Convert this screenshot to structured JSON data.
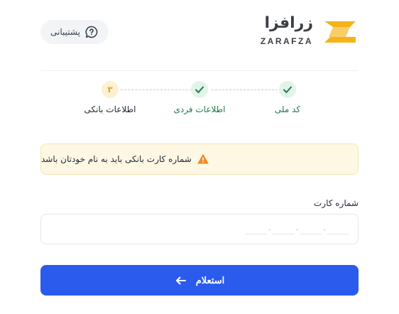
{
  "header": {
    "logo_fa": "زرافزا",
    "logo_en": "ZARAFZA",
    "support_label": "پشتیبانی",
    "brand_color": "#f5b31b"
  },
  "stepper": {
    "steps": [
      {
        "label": "کد ملی",
        "state": "done"
      },
      {
        "label": "اطلاعات فردی",
        "state": "done"
      },
      {
        "label": "اطلاعات بانکی",
        "state": "active",
        "number": "۳"
      }
    ]
  },
  "alert": {
    "text": "شماره کارت بانکی باید به نام خودتان باشد",
    "icon": "warning-icon",
    "color": "#f08a24"
  },
  "form": {
    "card_label": "شماره کارت",
    "card_value": "",
    "card_placeholder": "____-____-____-____"
  },
  "submit": {
    "label": "استعلام",
    "color": "#2b5bec",
    "icon": "arrow-left-icon"
  }
}
